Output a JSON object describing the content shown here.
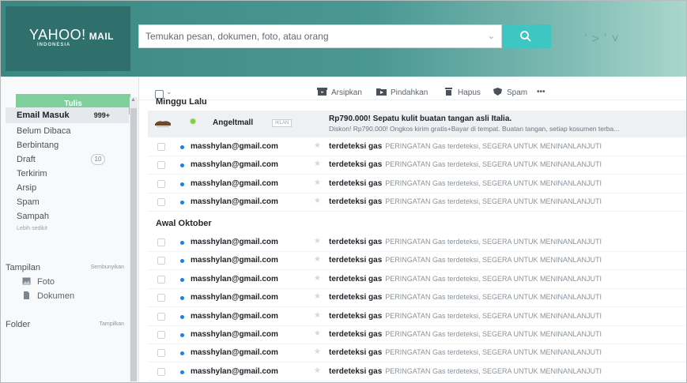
{
  "header": {
    "logo_text": "YAHOO!",
    "logo_suffix": "MAIL",
    "logo_sub": "INDONESIA",
    "search_placeholder": "Temukan pesan, dokumen, foto, atau orang"
  },
  "sidebar": {
    "compose_label": "Tulis",
    "folders": [
      {
        "label": "Email Masuk",
        "count": "999+"
      },
      {
        "label": "Belum Dibaca"
      },
      {
        "label": "Berbintang"
      },
      {
        "label": "Draft",
        "count": "10"
      },
      {
        "label": "Terkirim"
      },
      {
        "label": "Arsip"
      },
      {
        "label": "Spam"
      },
      {
        "label": "Sampah"
      }
    ],
    "less_label": "Lebih sedikit",
    "views_label": "Tampilan",
    "views_toggle": "Sembunyikan",
    "views": [
      {
        "label": "Foto",
        "icon": "photo-icon"
      },
      {
        "label": "Dokumen",
        "icon": "document-icon"
      }
    ],
    "folder_label": "Folder",
    "folder_toggle": "Tampilkan"
  },
  "toolbar": {
    "archive_label": "Arsipkan",
    "move_label": "Pindahkan",
    "delete_label": "Hapus",
    "spam_label": "Spam",
    "more_label": "•••"
  },
  "list": {
    "groups": [
      {
        "title": "Minggu Lalu"
      },
      {
        "title": "Awal Oktober"
      }
    ],
    "ad": {
      "sender": "Angeltmall",
      "tag": "IKLAN",
      "subject": "Rp790.000! Sepatu kulit buatan tangan asli Italia.",
      "preview": "Diskon! Rp790.000! Ongkos kirim gratis+Bayar di tempat. Buatan tangan, setiap kosumen terba..."
    },
    "messages": [
      {
        "sender": "masshylan@gmail.com",
        "subject": "terdeteksi gas",
        "preview": "PERINGATAN Gas terdeteksi, SEGERA UNTUK MENINANLANJUTI"
      },
      {
        "sender": "masshylan@gmail.com",
        "subject": "terdeteksi gas",
        "preview": "PERINGATAN Gas terdeteksi, SEGERA UNTUK MENINANLANJUTI"
      },
      {
        "sender": "masshylan@gmail.com",
        "subject": "terdeteksi gas",
        "preview": "PERINGATAN Gas terdeteksi, SEGERA UNTUK MENINANLANJUTI"
      },
      {
        "sender": "masshylan@gmail.com",
        "subject": "terdeteksi gas",
        "preview": "PERINGATAN Gas terdeteksi, SEGERA UNTUK MENINANLANJUTI"
      },
      {
        "sender": "masshylan@gmail.com",
        "subject": "terdeteksi gas",
        "preview": "PERINGATAN Gas terdeteksi, SEGERA UNTUK MENINANLANJUTI"
      },
      {
        "sender": "masshylan@gmail.com",
        "subject": "terdeteksi gas",
        "preview": "PERINGATAN Gas terdeteksi, SEGERA UNTUK MENINANLANJUTI"
      },
      {
        "sender": "masshylan@gmail.com",
        "subject": "terdeteksi gas",
        "preview": "PERINGATAN Gas terdeteksi, SEGERA UNTUK MENINANLANJUTI"
      },
      {
        "sender": "masshylan@gmail.com",
        "subject": "terdeteksi gas",
        "preview": "PERINGATAN Gas terdeteksi, SEGERA UNTUK MENINANLANJUTI"
      },
      {
        "sender": "masshylan@gmail.com",
        "subject": "terdeteksi gas",
        "preview": "PERINGATAN Gas terdeteksi, SEGERA UNTUK MENINANLANJUTI"
      },
      {
        "sender": "masshylan@gmail.com",
        "subject": "terdeteksi gas",
        "preview": "PERINGATAN Gas terdeteksi, SEGERA UNTUK MENINANLANJUTI"
      },
      {
        "sender": "masshylan@gmail.com",
        "subject": "terdeteksi gas",
        "preview": "PERINGATAN Gas terdeteksi, SEGERA UNTUK MENINANLANJUTI"
      },
      {
        "sender": "masshylan@gmail.com",
        "subject": "terdeteksi gas",
        "preview": "PERINGATAN Gas terdeteksi, SEGERA UNTUK MENINANLANJUTI"
      }
    ]
  },
  "colors": {
    "header": "#3d8a86",
    "compose": "#7fcf9d",
    "search_button": "#3ec7c2",
    "unread_dot": "#1d7fe0"
  }
}
